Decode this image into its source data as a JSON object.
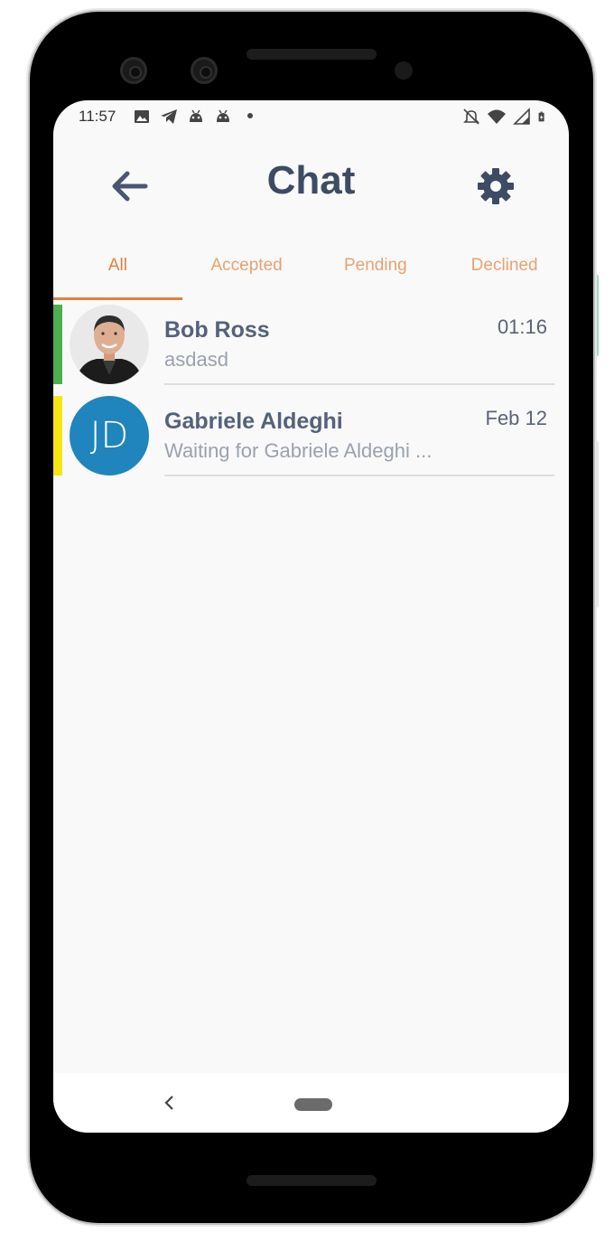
{
  "status_bar": {
    "time": "11:57",
    "left_icons": [
      "image-icon",
      "telegram-icon",
      "android-icon",
      "android-icon",
      "dot-icon"
    ],
    "right_icons": [
      "bell-off-icon",
      "wifi-icon",
      "signal-icon",
      "battery-charging-icon"
    ]
  },
  "header": {
    "title": "Chat",
    "back_icon": "arrow-left-icon",
    "settings_icon": "gear-icon"
  },
  "tabs": [
    {
      "label": "All",
      "active": true
    },
    {
      "label": "Accepted",
      "active": false
    },
    {
      "label": "Pending",
      "active": false
    },
    {
      "label": "Declined",
      "active": false
    }
  ],
  "chats": [
    {
      "name": "Bob Ross",
      "time": "01:16",
      "preview": "asdasd",
      "status_color": "#4caf50",
      "avatar": "photo"
    },
    {
      "name": "Gabriele Aldeghi",
      "time": "Feb 12",
      "preview": "Waiting for Gabriele Aldeghi ...",
      "status_color": "#f5e614",
      "avatar_initials": "JD",
      "avatar_color": "#1f85bc"
    }
  ],
  "colors": {
    "accent": "#e37f3f",
    "title": "#3d4b63"
  }
}
